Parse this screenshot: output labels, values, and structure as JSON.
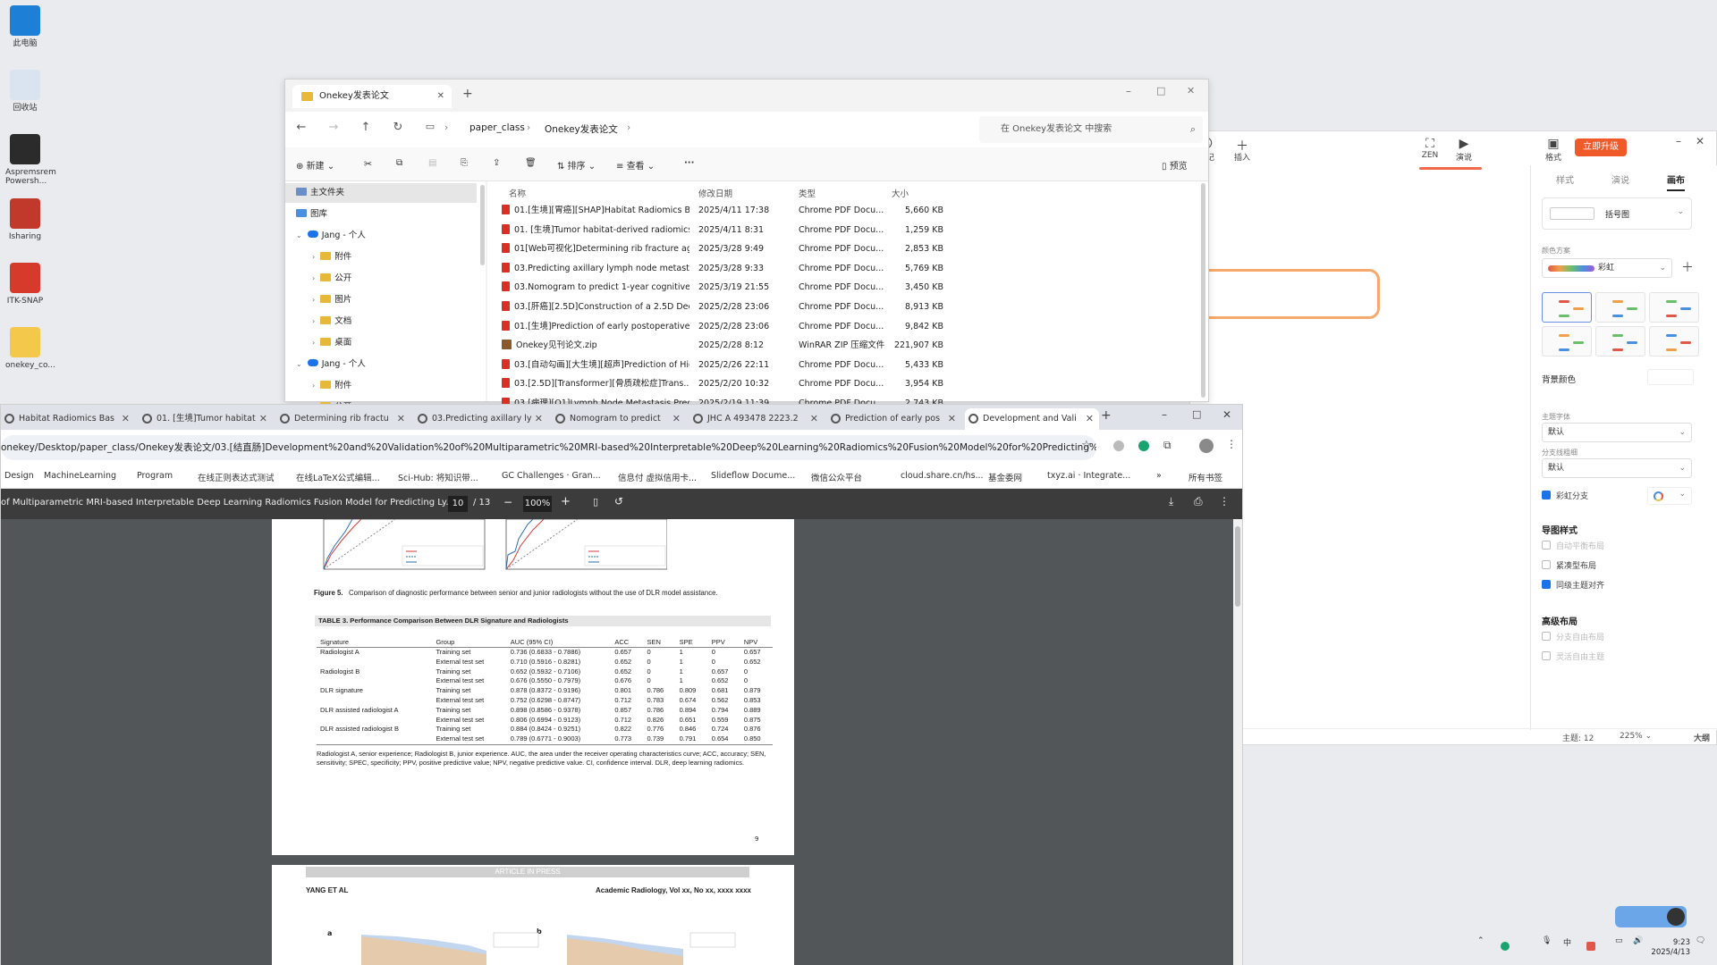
{
  "desktop": {
    "icons": [
      {
        "label": "此电脑",
        "color": "#1d7fd6"
      },
      {
        "label": "回收站",
        "color": "#d9e4f0"
      },
      {
        "label": "Aspremsrem Powersh...",
        "color": "#2b2b2b"
      },
      {
        "label": "Isharing",
        "color": "#c0392b"
      },
      {
        "label": "ITK-SNAP",
        "color": "#d63a2a"
      },
      {
        "label": "onekey_co...",
        "color": "#f3c84b"
      }
    ]
  },
  "mindmap": {
    "tools": [
      "标记",
      "插入",
      "ZEN",
      "演说",
      "格式"
    ],
    "upgrade_label": "立即升级",
    "panel_tabs": [
      "样式",
      "演说",
      "画布"
    ],
    "structure_value": "括号图",
    "color_scheme_label": "颜色方案",
    "color_scheme_value": "彩虹",
    "bg_label": "背景颜色",
    "main_font_label": "主题字体",
    "main_font_value": "默认",
    "branch_width_label": "分支线粗细",
    "branch_width_value": "默认",
    "rainbow_branch": "彩虹分支",
    "map_style_label": "导图样式",
    "map_style_options": [
      {
        "label": "自动平衡布局",
        "checked": false,
        "disabled": true
      },
      {
        "label": "紧凑型布局",
        "checked": false,
        "disabled": false
      },
      {
        "label": "同级主题对齐",
        "checked": true,
        "disabled": false
      }
    ],
    "advanced_label": "高级布局",
    "advanced_options": [
      {
        "label": "分支自由布局",
        "checked": false,
        "disabled": true
      },
      {
        "label": "灵活自由主题",
        "checked": false,
        "disabled": true
      }
    ],
    "status_topics": "主题: 12",
    "status_zoom": "225%",
    "status_outline": "大纲"
  },
  "explorer": {
    "tab_title": "Onekey发表论文",
    "breadcrumb": [
      "paper_class",
      "Onekey发表论文"
    ],
    "search_placeholder": "在 Onekey发表论文 中搜索",
    "toolbar": {
      "new": "新建",
      "sort": "排序",
      "view": "查看",
      "preview": "预览"
    },
    "nav": [
      {
        "label": "主文件夹",
        "type": "home",
        "indent": 0,
        "selected": true
      },
      {
        "label": "图库",
        "type": "gallery",
        "indent": 0,
        "selected": false
      },
      {
        "label": "Jang - 个人",
        "type": "cloud",
        "indent": 0,
        "selected": false
      },
      {
        "label": "附件",
        "type": "folder",
        "indent": 1,
        "selected": false
      },
      {
        "label": "公开",
        "type": "folder",
        "indent": 1,
        "selected": false
      },
      {
        "label": "图片",
        "type": "folder",
        "indent": 1,
        "selected": false
      },
      {
        "label": "文档",
        "type": "folder",
        "indent": 1,
        "selected": false
      },
      {
        "label": "桌面",
        "type": "folder",
        "indent": 1,
        "selected": false
      },
      {
        "label": "Jang - 个人",
        "type": "cloud",
        "indent": 0,
        "selected": false
      },
      {
        "label": "附件",
        "type": "folder",
        "indent": 1,
        "selected": false
      },
      {
        "label": "公开",
        "type": "folder",
        "indent": 1,
        "selected": false
      }
    ],
    "columns": [
      "名称",
      "修改日期",
      "类型",
      "大小"
    ],
    "files": [
      {
        "name": "01.[生境][胃癌][SHAP]Habitat Radiomics Bas...",
        "date": "2025/4/11 17:38",
        "type": "Chrome PDF Docu...",
        "size": "5,660 KB",
        "kind": "pdf"
      },
      {
        "name": "01. [生境]Tumor habitat-derived radiomics f...",
        "date": "2025/4/11 8:31",
        "type": "Chrome PDF Docu...",
        "size": "1,259 KB",
        "kind": "pdf"
      },
      {
        "name": "01[Web可视化]Determining rib fracture age...",
        "date": "2025/3/28 9:49",
        "type": "Chrome PDF Docu...",
        "size": "2,853 KB",
        "kind": "pdf"
      },
      {
        "name": "03.Predicting axillary lymph node metastasi...",
        "date": "2025/3/28 9:33",
        "type": "Chrome PDF Docu...",
        "size": "5,769 KB",
        "kind": "pdf"
      },
      {
        "name": "03.Nomogram to predict 1-year cognitive d...",
        "date": "2025/3/19 21:55",
        "type": "Chrome PDF Docu...",
        "size": "3,450 KB",
        "kind": "pdf"
      },
      {
        "name": "03.[肝癌][2.5D]Construction of a 2.5D Deep ...",
        "date": "2025/2/28 23:06",
        "type": "Chrome PDF Docu...",
        "size": "8,913 KB",
        "kind": "pdf"
      },
      {
        "name": "01.[生境]Prediction of early postoperative re...",
        "date": "2025/2/28 23:06",
        "type": "Chrome PDF Docu...",
        "size": "9,842 KB",
        "kind": "pdf"
      },
      {
        "name": "Onekey见刊论文.zip",
        "date": "2025/2/28 8:12",
        "type": "WinRAR ZIP 压缩文件",
        "size": "221,907 KB",
        "kind": "zip"
      },
      {
        "name": "03.[自动勾画][大生境][超声]Prediction of Hig...",
        "date": "2025/2/26 22:11",
        "type": "Chrome PDF Docu...",
        "size": "5,433 KB",
        "kind": "pdf"
      },
      {
        "name": "03.[2.5D][Transformer][骨质疏松症]Trans...",
        "date": "2025/2/20 10:32",
        "type": "Chrome PDF Docu...",
        "size": "3,954 KB",
        "kind": "pdf"
      },
      {
        "name": "03.[病理][Q1]Lymph Node Metastasis Predi...",
        "date": "2025/2/19 11:39",
        "type": "Chrome PDF Docu...",
        "size": "2,743 KB",
        "kind": "pdf"
      }
    ]
  },
  "chrome": {
    "tabs": [
      {
        "title": "Habitat Radiomics Bas",
        "active": false
      },
      {
        "title": "01. [生境]Tumor habitat",
        "active": false
      },
      {
        "title": "Determining rib fractu",
        "active": false
      },
      {
        "title": "03.Predicting axillary ly",
        "active": false
      },
      {
        "title": "Nomogram to predict",
        "active": false
      },
      {
        "title": "JHC A 493478 2223.2",
        "active": false
      },
      {
        "title": "Prediction of early pos",
        "active": false
      },
      {
        "title": "Development and Vali",
        "active": true
      }
    ],
    "url": "onekey/Desktop/paper_class/Onekey发表论文/03.[结直肠]Development%20and%20Validation%20of%20Multiparametric%20MRI-based%20Interpretable%20Deep%20Learning%20Radiomics%20Fusion%20Model%20for%20Predicting%20...",
    "bookmarks": [
      "Design",
      "MachineLearning",
      "Program",
      "在线正则表达式测试",
      "在线LaTeX公式编辑...",
      "Sci-Hub: 将知识带...",
      "GC Challenges · Gran...",
      "信息付 虚拟信用卡...",
      "Slideflow Docume...",
      "微信公众平台",
      "cloud.share.cn/hs...",
      "基金委网",
      "txyz.ai · Integrate...",
      "所有书签"
    ]
  },
  "pdf": {
    "title": "of Multiparametric MRI-based Interpretable Deep Learning Radiomics Fusion Model for Predicting Ly...",
    "page": "10",
    "total": "/ 13",
    "zoom": "100%",
    "figure_caption_label": "Figure 5.",
    "figure_caption": "Comparison of diagnostic performance between senior and junior radiologists without the use of DLR model assistance.",
    "table_title": "TABLE 3. Performance Comparison Between DLR Signature and Radiologists",
    "table_headers": [
      "Signature",
      "Group",
      "AUC (95% CI)",
      "ACC",
      "SEN",
      "SPE",
      "PPV",
      "NPV"
    ],
    "table_rows": [
      [
        "Radiologist A",
        "Training set",
        "0.736 (0.6833 - 0.7886)",
        "0.657",
        "0",
        "1",
        "0",
        "0.657"
      ],
      [
        "",
        "External test set",
        "0.710 (0.5916 - 0.8281)",
        "0.652",
        "0",
        "1",
        "0",
        "0.652"
      ],
      [
        "Radiologist B",
        "Training set",
        "0.652 (0.5932 - 0.7106)",
        "0.652",
        "0",
        "1",
        "0.657",
        "0"
      ],
      [
        "",
        "External test set",
        "0.676 (0.5550 - 0.7979)",
        "0.676",
        "0",
        "1",
        "0.652",
        "0"
      ],
      [
        "DLR signature",
        "Training set",
        "0.878 (0.8372 - 0.9196)",
        "0.801",
        "0.786",
        "0.809",
        "0.681",
        "0.879"
      ],
      [
        "",
        "External test set",
        "0.752 (0.6298 - 0.8747)",
        "0.712",
        "0.783",
        "0.674",
        "0.562",
        "0.853"
      ],
      [
        "DLR assisted radiologist A",
        "Training set",
        "0.898 (0.8586 - 0.9378)",
        "0.857",
        "0.786",
        "0.894",
        "0.794",
        "0.889"
      ],
      [
        "",
        "External test set",
        "0.806 (0.6994 - 0.9123)",
        "0.712",
        "0.826",
        "0.651",
        "0.559",
        "0.875"
      ],
      [
        "DLR assisted radiologist B",
        "Training set",
        "0.884 (0.8424 - 0.9251)",
        "0.822",
        "0.776",
        "0.846",
        "0.724",
        "0.876"
      ],
      [
        "",
        "External test set",
        "0.789 (0.6771 - 0.9003)",
        "0.773",
        "0.739",
        "0.791",
        "0.654",
        "0.850"
      ]
    ],
    "table_note": "Radiologist A, senior experience; Radiologist B, junior experience. AUC, the area under the receiver operating characteristics curve; ACC, accuracy; SEN, sensitivity; SPEC, specificity; PPV, positive predictive value; NPV, negative predictive value. CI, confidence interval. DLR, deep learning radiomics.",
    "page_number": "9",
    "next_banner": "ARTICLE IN PRESS",
    "next_left_header": "YANG ET AL",
    "next_right_header": "Academic Radiology, Vol xx, No xx, xxxx xxxx",
    "panel_a": "a",
    "panel_b": "b"
  },
  "taskbar": {
    "time": "9:23",
    "date": "2025/4/13"
  }
}
